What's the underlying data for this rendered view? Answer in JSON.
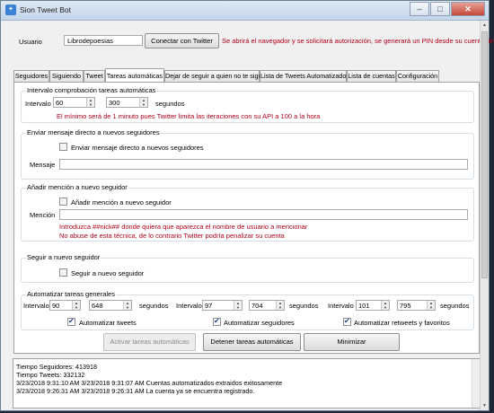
{
  "window": {
    "title": "Sion Tweet Bot",
    "minimize": "–",
    "maximize": "□",
    "close": "✕"
  },
  "account": {
    "user_label": "Usuario",
    "user_value": "Librodepoesias",
    "connect_button": "Conectar con Twitter",
    "notice": "Se abrirá el navegador y se solicitará autorización, se generará un PIN desde su cuenta de Twitter"
  },
  "tabs": [
    {
      "label": "Seguidores"
    },
    {
      "label": "Siguiendo"
    },
    {
      "label": "Tweet"
    },
    {
      "label": "Tareas automáticas",
      "active": true
    },
    {
      "label": "Dejar de seguir a quien no te sigue"
    },
    {
      "label": "Lista de Tweets Automatizados"
    },
    {
      "label": "Lista de cuentas"
    },
    {
      "label": "Configuración"
    }
  ],
  "interval_group": {
    "title": "Intervalo comprobación tareas automáticas",
    "interval_label": "Intervalo",
    "from": "60",
    "to": "300",
    "unit": "segundos",
    "warning": "El mínimo será de 1 minuto pues Twitter limita las iteraciones con su API a 100 a la hora"
  },
  "dm_group": {
    "title": "Enviar mensaje directo a nuevos seguidores",
    "checkbox": "Enviar mensaje directo a nuevos seguidores",
    "checked": false,
    "message_label": "Mensaje",
    "message_value": ""
  },
  "mention_group": {
    "title": "Añadir mención a nuevo seguidor",
    "checkbox": "Añadir mención a nuevo seguidor",
    "checked": false,
    "mention_label": "Mención",
    "mention_value": "",
    "hint1": "Introduzca ##nick## donde quiera que aparezca el nombre de usuario a mencionar",
    "hint2": "No abuse de esta técnica, de lo contrario Twitter podría penalizar su cuenta"
  },
  "follow_group": {
    "title": "Seguir a nuevo seguidor",
    "checkbox": "Seguir a nuevo seguidor",
    "checked": false
  },
  "general_group": {
    "title": "Automatizar tareas generales",
    "interval_label": "Intervalo",
    "unit": "segundos",
    "blocks": [
      {
        "from": "90",
        "to": "648",
        "checkbox": "Automatizar tweets",
        "checked": true
      },
      {
        "from": "97",
        "to": "704",
        "checkbox": "Automatizar seguidores",
        "checked": true
      },
      {
        "from": "101",
        "to": "795",
        "checkbox": "Automatizar retweets y favoritos",
        "checked": true
      }
    ]
  },
  "actions": {
    "activate": "Activar tareas automáticas",
    "stop": "Detener tareas automáticas",
    "minimize": "Minimizar"
  },
  "log": [
    "Tiempo Seguidores: 413918",
    "Tiempo Tweets: 332132",
    "3/23/2018 9:31:10 AM 3/23/2018 9:31:07 AM Cuentas automatizados extraidos exitosamente",
    "3/23/2018 9:26:31 AM 3/23/2018 9:26:31 AM La cuenta ya se encuentra registrado."
  ]
}
